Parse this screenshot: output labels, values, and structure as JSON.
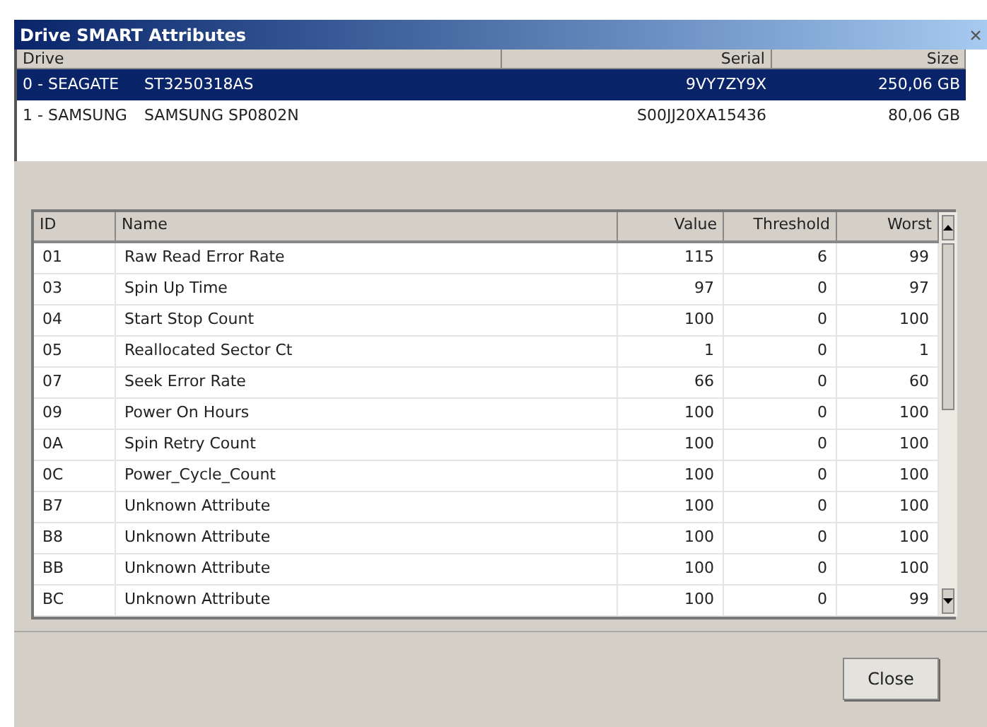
{
  "window": {
    "title": "Drive SMART Attributes"
  },
  "drives": {
    "columns": [
      "Drive",
      "Serial",
      "Size"
    ],
    "rows": [
      {
        "drive": "0 - SEAGATE",
        "model": "ST3250318AS",
        "serial": "9VY7ZY9X",
        "size": "250,06 GB",
        "selected": true
      },
      {
        "drive": "1 - SAMSUNG",
        "model": "SAMSUNG SP0802N",
        "serial": "S00JJ20XA15436",
        "size": "80,06 GB",
        "selected": false
      }
    ]
  },
  "attributes": {
    "columns": [
      "ID",
      "Name",
      "Value",
      "Threshold",
      "Worst"
    ],
    "rows": [
      [
        "01",
        "Raw Read Error Rate",
        "115",
        "6",
        "99"
      ],
      [
        "03",
        "Spin Up Time",
        "97",
        "0",
        "97"
      ],
      [
        "04",
        "Start Stop Count",
        "100",
        "0",
        "100"
      ],
      [
        "05",
        "Reallocated Sector Ct",
        "1",
        "0",
        "1"
      ],
      [
        "07",
        "Seek Error Rate",
        "66",
        "0",
        "60"
      ],
      [
        "09",
        "Power On Hours",
        "100",
        "0",
        "100"
      ],
      [
        "0A",
        "Spin Retry Count",
        "100",
        "0",
        "100"
      ],
      [
        "0C",
        "Power_Cycle_Count",
        "100",
        "0",
        "100"
      ],
      [
        "B7",
        "Unknown Attribute",
        "100",
        "0",
        "100"
      ],
      [
        "B8",
        "Unknown Attribute",
        "100",
        "0",
        "100"
      ],
      [
        "BB",
        "Unknown Attribute",
        "100",
        "0",
        "100"
      ],
      [
        "BC",
        "Unknown Attribute",
        "100",
        "0",
        "99"
      ]
    ]
  },
  "buttons": [
    "Close"
  ]
}
